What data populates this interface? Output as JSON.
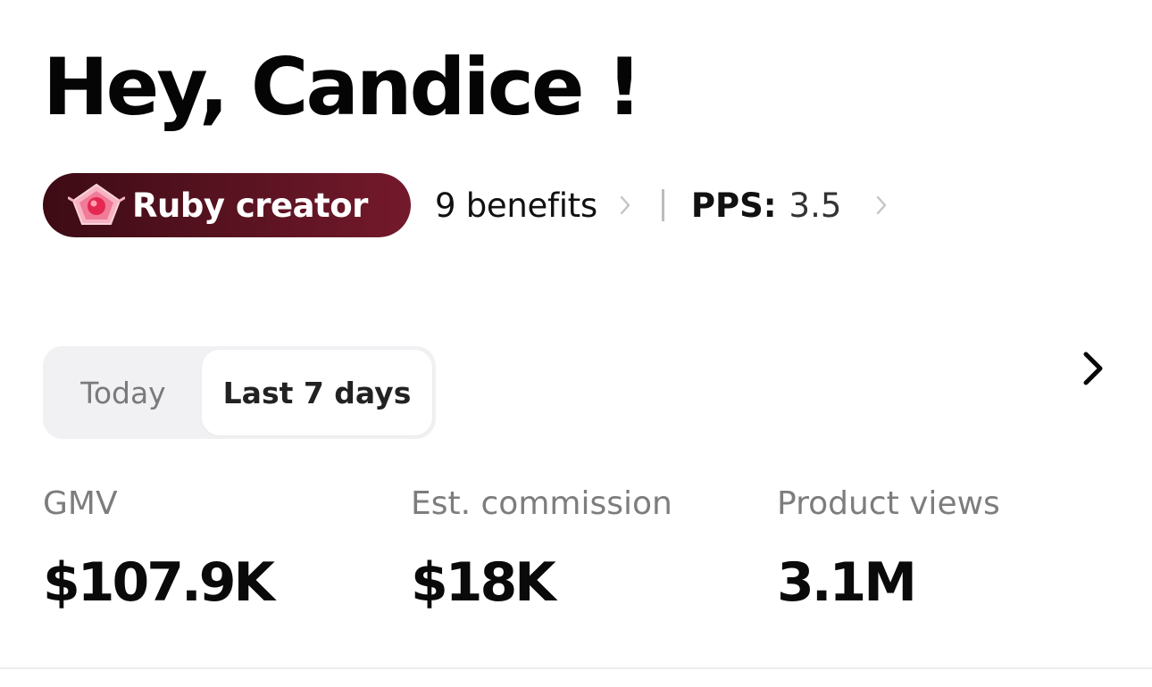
{
  "greeting": "Hey, Candice !",
  "tier": {
    "label": "Ruby creator",
    "icon": "ruby-gem-icon",
    "color": "#5a1321"
  },
  "benefits": {
    "label": "9 benefits"
  },
  "pps": {
    "label": "PPS:",
    "value": "3.5"
  },
  "period_toggle": {
    "options": [
      "Today",
      "Last 7 days"
    ],
    "selected": "Last 7 days"
  },
  "metrics": [
    {
      "label": "GMV",
      "value": "$107.9K"
    },
    {
      "label": "Est. commission",
      "value": "$18K"
    },
    {
      "label": "Product views",
      "value": "3.1M"
    }
  ]
}
